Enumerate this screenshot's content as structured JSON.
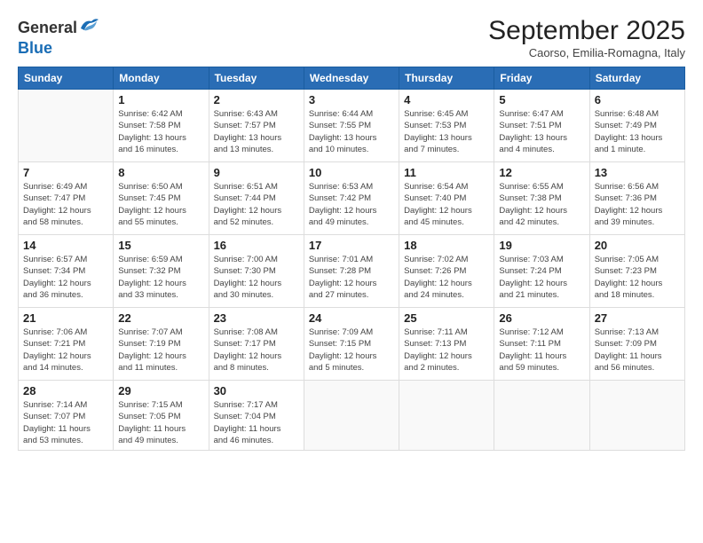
{
  "logo": {
    "text_general": "General",
    "text_blue": "Blue"
  },
  "title": {
    "month": "September 2025",
    "location": "Caorso, Emilia-Romagna, Italy"
  },
  "columns": [
    "Sunday",
    "Monday",
    "Tuesday",
    "Wednesday",
    "Thursday",
    "Friday",
    "Saturday"
  ],
  "weeks": [
    [
      {
        "day": "",
        "info": ""
      },
      {
        "day": "1",
        "info": "Sunrise: 6:42 AM\nSunset: 7:58 PM\nDaylight: 13 hours\nand 16 minutes."
      },
      {
        "day": "2",
        "info": "Sunrise: 6:43 AM\nSunset: 7:57 PM\nDaylight: 13 hours\nand 13 minutes."
      },
      {
        "day": "3",
        "info": "Sunrise: 6:44 AM\nSunset: 7:55 PM\nDaylight: 13 hours\nand 10 minutes."
      },
      {
        "day": "4",
        "info": "Sunrise: 6:45 AM\nSunset: 7:53 PM\nDaylight: 13 hours\nand 7 minutes."
      },
      {
        "day": "5",
        "info": "Sunrise: 6:47 AM\nSunset: 7:51 PM\nDaylight: 13 hours\nand 4 minutes."
      },
      {
        "day": "6",
        "info": "Sunrise: 6:48 AM\nSunset: 7:49 PM\nDaylight: 13 hours\nand 1 minute."
      }
    ],
    [
      {
        "day": "7",
        "info": "Sunrise: 6:49 AM\nSunset: 7:47 PM\nDaylight: 12 hours\nand 58 minutes."
      },
      {
        "day": "8",
        "info": "Sunrise: 6:50 AM\nSunset: 7:45 PM\nDaylight: 12 hours\nand 55 minutes."
      },
      {
        "day": "9",
        "info": "Sunrise: 6:51 AM\nSunset: 7:44 PM\nDaylight: 12 hours\nand 52 minutes."
      },
      {
        "day": "10",
        "info": "Sunrise: 6:53 AM\nSunset: 7:42 PM\nDaylight: 12 hours\nand 49 minutes."
      },
      {
        "day": "11",
        "info": "Sunrise: 6:54 AM\nSunset: 7:40 PM\nDaylight: 12 hours\nand 45 minutes."
      },
      {
        "day": "12",
        "info": "Sunrise: 6:55 AM\nSunset: 7:38 PM\nDaylight: 12 hours\nand 42 minutes."
      },
      {
        "day": "13",
        "info": "Sunrise: 6:56 AM\nSunset: 7:36 PM\nDaylight: 12 hours\nand 39 minutes."
      }
    ],
    [
      {
        "day": "14",
        "info": "Sunrise: 6:57 AM\nSunset: 7:34 PM\nDaylight: 12 hours\nand 36 minutes."
      },
      {
        "day": "15",
        "info": "Sunrise: 6:59 AM\nSunset: 7:32 PM\nDaylight: 12 hours\nand 33 minutes."
      },
      {
        "day": "16",
        "info": "Sunrise: 7:00 AM\nSunset: 7:30 PM\nDaylight: 12 hours\nand 30 minutes."
      },
      {
        "day": "17",
        "info": "Sunrise: 7:01 AM\nSunset: 7:28 PM\nDaylight: 12 hours\nand 27 minutes."
      },
      {
        "day": "18",
        "info": "Sunrise: 7:02 AM\nSunset: 7:26 PM\nDaylight: 12 hours\nand 24 minutes."
      },
      {
        "day": "19",
        "info": "Sunrise: 7:03 AM\nSunset: 7:24 PM\nDaylight: 12 hours\nand 21 minutes."
      },
      {
        "day": "20",
        "info": "Sunrise: 7:05 AM\nSunset: 7:23 PM\nDaylight: 12 hours\nand 18 minutes."
      }
    ],
    [
      {
        "day": "21",
        "info": "Sunrise: 7:06 AM\nSunset: 7:21 PM\nDaylight: 12 hours\nand 14 minutes."
      },
      {
        "day": "22",
        "info": "Sunrise: 7:07 AM\nSunset: 7:19 PM\nDaylight: 12 hours\nand 11 minutes."
      },
      {
        "day": "23",
        "info": "Sunrise: 7:08 AM\nSunset: 7:17 PM\nDaylight: 12 hours\nand 8 minutes."
      },
      {
        "day": "24",
        "info": "Sunrise: 7:09 AM\nSunset: 7:15 PM\nDaylight: 12 hours\nand 5 minutes."
      },
      {
        "day": "25",
        "info": "Sunrise: 7:11 AM\nSunset: 7:13 PM\nDaylight: 12 hours\nand 2 minutes."
      },
      {
        "day": "26",
        "info": "Sunrise: 7:12 AM\nSunset: 7:11 PM\nDaylight: 11 hours\nand 59 minutes."
      },
      {
        "day": "27",
        "info": "Sunrise: 7:13 AM\nSunset: 7:09 PM\nDaylight: 11 hours\nand 56 minutes."
      }
    ],
    [
      {
        "day": "28",
        "info": "Sunrise: 7:14 AM\nSunset: 7:07 PM\nDaylight: 11 hours\nand 53 minutes."
      },
      {
        "day": "29",
        "info": "Sunrise: 7:15 AM\nSunset: 7:05 PM\nDaylight: 11 hours\nand 49 minutes."
      },
      {
        "day": "30",
        "info": "Sunrise: 7:17 AM\nSunset: 7:04 PM\nDaylight: 11 hours\nand 46 minutes."
      },
      {
        "day": "",
        "info": ""
      },
      {
        "day": "",
        "info": ""
      },
      {
        "day": "",
        "info": ""
      },
      {
        "day": "",
        "info": ""
      }
    ]
  ]
}
